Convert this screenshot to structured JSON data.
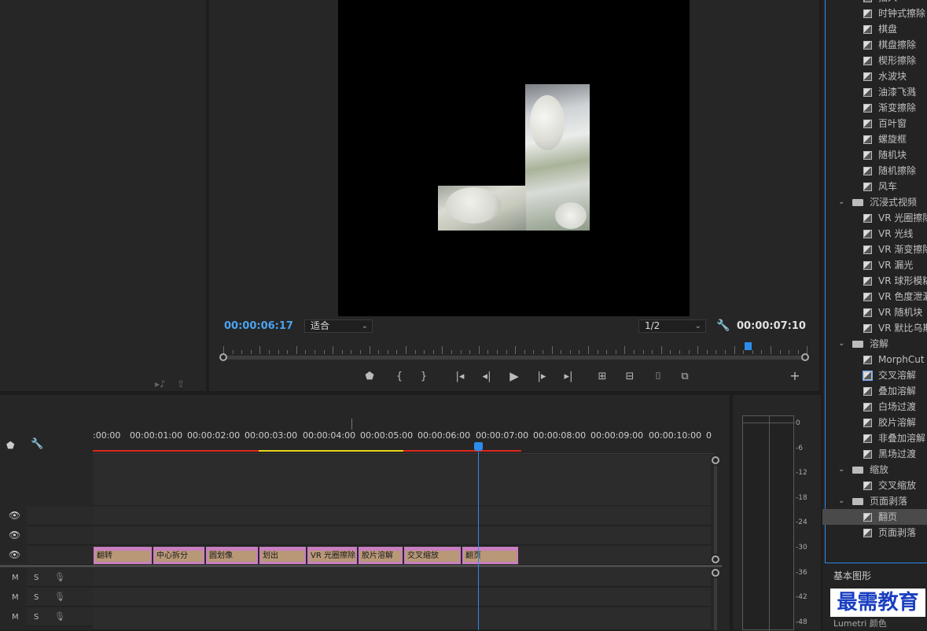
{
  "program": {
    "current_time": "00:00:06:17",
    "fit_label": "适合",
    "resolution_label": "1/2",
    "duration": "00:00:07:10"
  },
  "effects": {
    "items": [
      {
        "type": "item",
        "label": "插入"
      },
      {
        "type": "item",
        "label": "时钟式擦除"
      },
      {
        "type": "item",
        "label": "棋盘"
      },
      {
        "type": "item",
        "label": "棋盘擦除"
      },
      {
        "type": "item",
        "label": "楔形擦除"
      },
      {
        "type": "item",
        "label": "水波块"
      },
      {
        "type": "item",
        "label": "油漆飞溅"
      },
      {
        "type": "item",
        "label": "渐变擦除"
      },
      {
        "type": "item",
        "label": "百叶窗"
      },
      {
        "type": "item",
        "label": "螺旋框"
      },
      {
        "type": "item",
        "label": "随机块"
      },
      {
        "type": "item",
        "label": "随机擦除"
      },
      {
        "type": "item",
        "label": "风车"
      },
      {
        "type": "folder",
        "label": "沉浸式视频"
      },
      {
        "type": "item",
        "label": "VR 光圈擦除"
      },
      {
        "type": "item",
        "label": "VR 光线"
      },
      {
        "type": "item",
        "label": "VR 渐变擦除"
      },
      {
        "type": "item",
        "label": "VR 漏光"
      },
      {
        "type": "item",
        "label": "VR 球形模糊"
      },
      {
        "type": "item",
        "label": "VR 色度泄漏"
      },
      {
        "type": "item",
        "label": "VR 随机块"
      },
      {
        "type": "item",
        "label": "VR 默比乌斯"
      },
      {
        "type": "folder",
        "label": "溶解"
      },
      {
        "type": "item",
        "label": "MorphCut"
      },
      {
        "type": "item",
        "label": "交叉溶解",
        "focus": true
      },
      {
        "type": "item",
        "label": "叠加溶解"
      },
      {
        "type": "item",
        "label": "白场过渡"
      },
      {
        "type": "item",
        "label": "胶片溶解"
      },
      {
        "type": "item",
        "label": "非叠加溶解"
      },
      {
        "type": "item",
        "label": "黑场过渡"
      },
      {
        "type": "folder",
        "label": "缩放"
      },
      {
        "type": "item",
        "label": "交叉缩放"
      },
      {
        "type": "folder",
        "label": "页面剥落"
      },
      {
        "type": "item",
        "label": "翻页",
        "selected": true
      },
      {
        "type": "item",
        "label": "页面剥落"
      }
    ]
  },
  "bottom_panel": {
    "basic_graphics": "基本图形",
    "lumetri": "Lumetri 颜色",
    "watermark": "最需教育"
  },
  "timeline": {
    "ruler_labels": [
      ":00:00",
      "00:00:01:00",
      "00:00:02:00",
      "00:00:03:00",
      "00:00:04:00",
      "00:00:05:00",
      "00:00:06:00",
      "00:00:07:00",
      "00:00:08:00",
      "00:00:09:00",
      "00:00:10:00",
      "0"
    ],
    "clips": [
      {
        "name": "翻转"
      },
      {
        "name": "中心拆分"
      },
      {
        "name": "圆划像"
      },
      {
        "name": "划出"
      },
      {
        "name": "VR 光圈擦除"
      },
      {
        "name": "胶片溶解"
      },
      {
        "name": "交叉缩放"
      },
      {
        "name": "翻页"
      }
    ],
    "audio_m": "M",
    "audio_s": "S"
  },
  "meter": {
    "db_labels": [
      "0",
      "-6",
      "-12",
      "-18",
      "-24",
      "-30",
      "-36",
      "-42",
      "-48"
    ]
  },
  "colors": {
    "accent_blue": "#2d8ceb",
    "clip_pink": "#c97fc0",
    "render_red": "#e0261c",
    "render_yellow": "#e6d51a"
  }
}
